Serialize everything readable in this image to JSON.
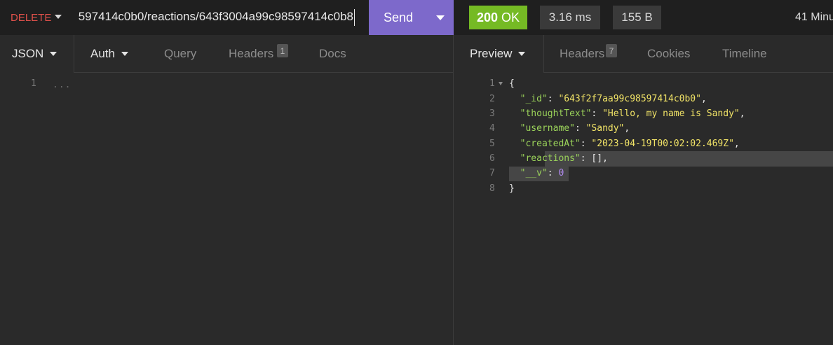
{
  "request": {
    "method": "DELETE",
    "url": "597414c0b0/reactions/643f3004a99c98597414c0b8",
    "send_label": "Send"
  },
  "response_meta": {
    "status_code": "200",
    "status_text": "OK",
    "time": "3.16 ms",
    "size": "155 B",
    "age": "41 Minu"
  },
  "request_tabs": {
    "body_type": "JSON",
    "auth": "Auth",
    "query": "Query",
    "headers": "Headers",
    "headers_count": "1",
    "docs": "Docs"
  },
  "request_body": {
    "line_numbers": [
      "1"
    ],
    "placeholder": "..."
  },
  "response_tabs": {
    "preview": "Preview",
    "headers": "Headers",
    "headers_count": "7",
    "cookies": "Cookies",
    "timeline": "Timeline"
  },
  "response_body": {
    "line_numbers": [
      "1",
      "2",
      "3",
      "4",
      "5",
      "6",
      "7",
      "8"
    ],
    "open_brace": "{",
    "close_brace": "}",
    "fields": [
      {
        "key": "\"_id\"",
        "value": "\"643f2f7aa99c98597414c0b0\"",
        "suffix": ","
      },
      {
        "key": "\"thoughtText\"",
        "value": "\"Hello, my name is Sandy\"",
        "suffix": ","
      },
      {
        "key": "\"username\"",
        "value": "\"Sandy\"",
        "suffix": ","
      },
      {
        "key": "\"createdAt\"",
        "value": "\"2023-04-19T00:02:02.469Z\"",
        "suffix": ","
      },
      {
        "key": "\"reactions\"",
        "value": "[]",
        "suffix": ","
      },
      {
        "key": "\"__v\"",
        "value": "0",
        "suffix": ""
      }
    ]
  },
  "colors": {
    "method": "#e0514b",
    "send": "#7d69cb",
    "status_ok": "#75ba24",
    "json_key": "#9bd35a",
    "json_string": "#f2e467",
    "json_number": "#b38cf3"
  }
}
